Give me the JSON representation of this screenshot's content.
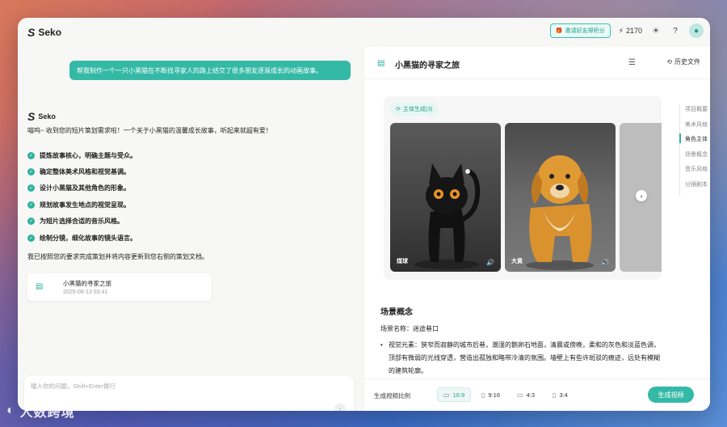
{
  "app": {
    "name": "Seko"
  },
  "topbar": {
    "promo_label": "邀请好友得积分",
    "credits": "2170"
  },
  "chat": {
    "user_message": "帮我制作一个一只小黑猫在不断找寻家人的路上结交了很多朋友逐渐成长的动画故事。",
    "bot_name": "Seko",
    "bot_intro": "喵呜~ 收到您的短片策划需求啦！一个关于小黑猫的温馨成长故事，听起来就超有爱！",
    "steps": [
      "提炼故事核心，明确主题与受众。",
      "确定整体美术风格和视觉基调。",
      "设计小黑猫及其他角色的形象。",
      "规划故事发生地点的视觉呈现。",
      "为短片选择合适的音乐风格。",
      "绘制分镜，细化故事的镜头语言。"
    ],
    "bot_done": "我已按照您的要求完成策划并将内容更新到您右侧的策划文档。",
    "doc_card": {
      "title": "小黑猫的寻家之旅",
      "time": "2025-08-13 03:41"
    },
    "input_placeholder": "输入你的问题，Shift+Enter换行"
  },
  "doc": {
    "title": "小黑猫的寻家之旅",
    "history_label": "历史文件",
    "characters_badge": "主体生成(3)",
    "characters": [
      {
        "name": "煤球"
      },
      {
        "name": "大黄"
      }
    ],
    "toc": [
      "项目概要",
      "美术风格",
      "角色主体",
      "场景概念",
      "音乐风格",
      "分镜剧本"
    ],
    "toc_active_index": 2,
    "scene": {
      "heading": "场景概念",
      "name_line": "场景名称：迷途巷口",
      "bullet": "视觉元素：狭窄而寂静的城市后巷，潮湿的鹅卵石地面，清晨或傍晚，柔和的灰色和淡蓝色调，顶部有微弱的光线穿透，营造出孤独和略带冷清的氛围。墙壁上有些许斑驳的痕迹，远处有模糊的建筑轮廓。"
    },
    "footer": {
      "ratio_label": "生成视频比例",
      "ratios": [
        "16:9",
        "9:16",
        "4:3",
        "3:4"
      ],
      "selected_ratio": "16:9",
      "generate_label": "生成视频"
    }
  },
  "watermark": {
    "text": "人数跨境"
  }
}
